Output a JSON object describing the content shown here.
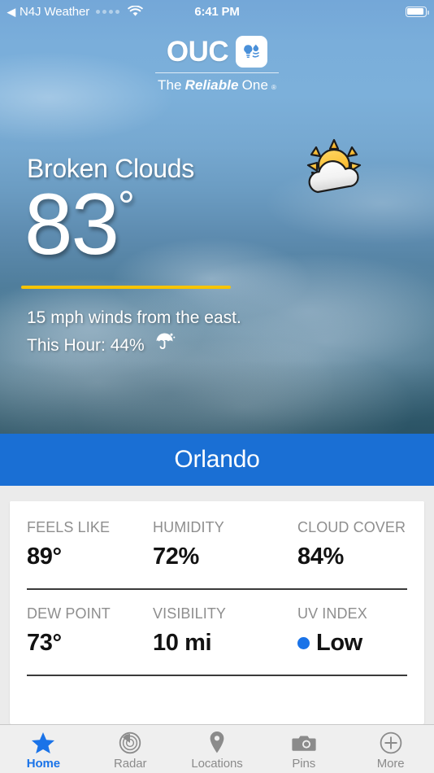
{
  "status_bar": {
    "back_glyph": "◀",
    "carrier": "N4J Weather",
    "signal_icon": "signal-dots-icon",
    "wifi_icon": "wifi-icon",
    "time": "6:41 PM",
    "battery_icon": "battery-icon"
  },
  "brand": {
    "name": "OUC",
    "mark_icon": "lightbulb-waterdrop-icon",
    "tagline_prefix": "The",
    "tagline_em": "Reliable",
    "tagline_suffix": "One",
    "registered": "®"
  },
  "hero": {
    "condition": "Broken Clouds",
    "condition_icon": "sun-behind-cloud-icon",
    "temperature": "83",
    "degree": "°",
    "wind_line": "15 mph winds from the east.",
    "precip_line": "This Hour: 44%",
    "precip_icon": "umbrella-icon",
    "accent_rule_color": "#f7c400"
  },
  "city_banner": {
    "city": "Orlando",
    "background": "#1a6fd4"
  },
  "details": {
    "rows": [
      [
        {
          "label": "FEELS LIKE",
          "value": "89°"
        },
        {
          "label": "HUMIDITY",
          "value": "72%"
        },
        {
          "label": "CLOUD COVER",
          "value": "84%"
        }
      ],
      [
        {
          "label": "DEW POINT",
          "value": "73°"
        },
        {
          "label": "VISIBILITY",
          "value": "10 mi"
        },
        {
          "label": "UV INDEX",
          "value": "Low",
          "dot_color": "#1a73e8"
        }
      ]
    ]
  },
  "tabbar": {
    "active_color": "#1a73e8",
    "inactive_color": "#8b8b8b",
    "items": [
      {
        "label": "Home",
        "icon": "star-icon",
        "active": true
      },
      {
        "label": "Radar",
        "icon": "radar-icon",
        "active": false
      },
      {
        "label": "Locations",
        "icon": "map-pin-icon",
        "active": false
      },
      {
        "label": "Pins",
        "icon": "camera-icon",
        "active": false
      },
      {
        "label": "More",
        "icon": "plus-circle-icon",
        "active": false
      }
    ]
  }
}
